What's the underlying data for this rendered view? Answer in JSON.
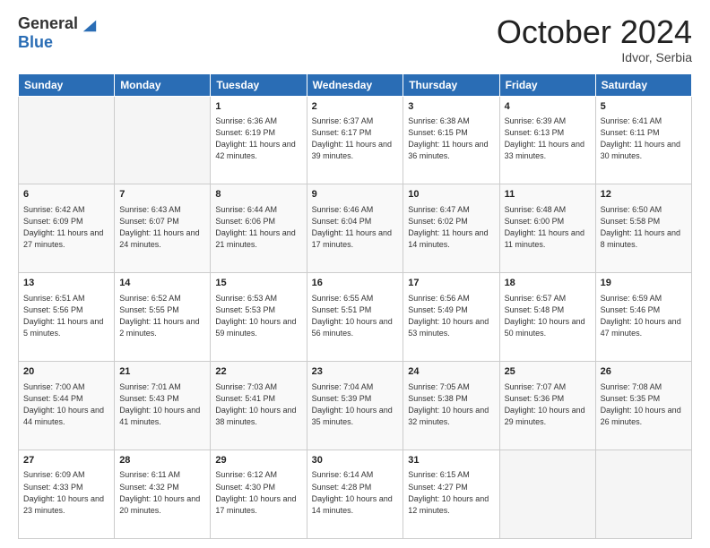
{
  "logo": {
    "general": "General",
    "blue": "Blue"
  },
  "header": {
    "month": "October 2024",
    "location": "Idvor, Serbia"
  },
  "weekdays": [
    "Sunday",
    "Monday",
    "Tuesday",
    "Wednesday",
    "Thursday",
    "Friday",
    "Saturday"
  ],
  "weeks": [
    [
      {
        "day": "",
        "sunrise": "",
        "sunset": "",
        "daylight": ""
      },
      {
        "day": "",
        "sunrise": "",
        "sunset": "",
        "daylight": ""
      },
      {
        "day": "1",
        "sunrise": "Sunrise: 6:36 AM",
        "sunset": "Sunset: 6:19 PM",
        "daylight": "Daylight: 11 hours and 42 minutes."
      },
      {
        "day": "2",
        "sunrise": "Sunrise: 6:37 AM",
        "sunset": "Sunset: 6:17 PM",
        "daylight": "Daylight: 11 hours and 39 minutes."
      },
      {
        "day": "3",
        "sunrise": "Sunrise: 6:38 AM",
        "sunset": "Sunset: 6:15 PM",
        "daylight": "Daylight: 11 hours and 36 minutes."
      },
      {
        "day": "4",
        "sunrise": "Sunrise: 6:39 AM",
        "sunset": "Sunset: 6:13 PM",
        "daylight": "Daylight: 11 hours and 33 minutes."
      },
      {
        "day": "5",
        "sunrise": "Sunrise: 6:41 AM",
        "sunset": "Sunset: 6:11 PM",
        "daylight": "Daylight: 11 hours and 30 minutes."
      }
    ],
    [
      {
        "day": "6",
        "sunrise": "Sunrise: 6:42 AM",
        "sunset": "Sunset: 6:09 PM",
        "daylight": "Daylight: 11 hours and 27 minutes."
      },
      {
        "day": "7",
        "sunrise": "Sunrise: 6:43 AM",
        "sunset": "Sunset: 6:07 PM",
        "daylight": "Daylight: 11 hours and 24 minutes."
      },
      {
        "day": "8",
        "sunrise": "Sunrise: 6:44 AM",
        "sunset": "Sunset: 6:06 PM",
        "daylight": "Daylight: 11 hours and 21 minutes."
      },
      {
        "day": "9",
        "sunrise": "Sunrise: 6:46 AM",
        "sunset": "Sunset: 6:04 PM",
        "daylight": "Daylight: 11 hours and 17 minutes."
      },
      {
        "day": "10",
        "sunrise": "Sunrise: 6:47 AM",
        "sunset": "Sunset: 6:02 PM",
        "daylight": "Daylight: 11 hours and 14 minutes."
      },
      {
        "day": "11",
        "sunrise": "Sunrise: 6:48 AM",
        "sunset": "Sunset: 6:00 PM",
        "daylight": "Daylight: 11 hours and 11 minutes."
      },
      {
        "day": "12",
        "sunrise": "Sunrise: 6:50 AM",
        "sunset": "Sunset: 5:58 PM",
        "daylight": "Daylight: 11 hours and 8 minutes."
      }
    ],
    [
      {
        "day": "13",
        "sunrise": "Sunrise: 6:51 AM",
        "sunset": "Sunset: 5:56 PM",
        "daylight": "Daylight: 11 hours and 5 minutes."
      },
      {
        "day": "14",
        "sunrise": "Sunrise: 6:52 AM",
        "sunset": "Sunset: 5:55 PM",
        "daylight": "Daylight: 11 hours and 2 minutes."
      },
      {
        "day": "15",
        "sunrise": "Sunrise: 6:53 AM",
        "sunset": "Sunset: 5:53 PM",
        "daylight": "Daylight: 10 hours and 59 minutes."
      },
      {
        "day": "16",
        "sunrise": "Sunrise: 6:55 AM",
        "sunset": "Sunset: 5:51 PM",
        "daylight": "Daylight: 10 hours and 56 minutes."
      },
      {
        "day": "17",
        "sunrise": "Sunrise: 6:56 AM",
        "sunset": "Sunset: 5:49 PM",
        "daylight": "Daylight: 10 hours and 53 minutes."
      },
      {
        "day": "18",
        "sunrise": "Sunrise: 6:57 AM",
        "sunset": "Sunset: 5:48 PM",
        "daylight": "Daylight: 10 hours and 50 minutes."
      },
      {
        "day": "19",
        "sunrise": "Sunrise: 6:59 AM",
        "sunset": "Sunset: 5:46 PM",
        "daylight": "Daylight: 10 hours and 47 minutes."
      }
    ],
    [
      {
        "day": "20",
        "sunrise": "Sunrise: 7:00 AM",
        "sunset": "Sunset: 5:44 PM",
        "daylight": "Daylight: 10 hours and 44 minutes."
      },
      {
        "day": "21",
        "sunrise": "Sunrise: 7:01 AM",
        "sunset": "Sunset: 5:43 PM",
        "daylight": "Daylight: 10 hours and 41 minutes."
      },
      {
        "day": "22",
        "sunrise": "Sunrise: 7:03 AM",
        "sunset": "Sunset: 5:41 PM",
        "daylight": "Daylight: 10 hours and 38 minutes."
      },
      {
        "day": "23",
        "sunrise": "Sunrise: 7:04 AM",
        "sunset": "Sunset: 5:39 PM",
        "daylight": "Daylight: 10 hours and 35 minutes."
      },
      {
        "day": "24",
        "sunrise": "Sunrise: 7:05 AM",
        "sunset": "Sunset: 5:38 PM",
        "daylight": "Daylight: 10 hours and 32 minutes."
      },
      {
        "day": "25",
        "sunrise": "Sunrise: 7:07 AM",
        "sunset": "Sunset: 5:36 PM",
        "daylight": "Daylight: 10 hours and 29 minutes."
      },
      {
        "day": "26",
        "sunrise": "Sunrise: 7:08 AM",
        "sunset": "Sunset: 5:35 PM",
        "daylight": "Daylight: 10 hours and 26 minutes."
      }
    ],
    [
      {
        "day": "27",
        "sunrise": "Sunrise: 6:09 AM",
        "sunset": "Sunset: 4:33 PM",
        "daylight": "Daylight: 10 hours and 23 minutes."
      },
      {
        "day": "28",
        "sunrise": "Sunrise: 6:11 AM",
        "sunset": "Sunset: 4:32 PM",
        "daylight": "Daylight: 10 hours and 20 minutes."
      },
      {
        "day": "29",
        "sunrise": "Sunrise: 6:12 AM",
        "sunset": "Sunset: 4:30 PM",
        "daylight": "Daylight: 10 hours and 17 minutes."
      },
      {
        "day": "30",
        "sunrise": "Sunrise: 6:14 AM",
        "sunset": "Sunset: 4:28 PM",
        "daylight": "Daylight: 10 hours and 14 minutes."
      },
      {
        "day": "31",
        "sunrise": "Sunrise: 6:15 AM",
        "sunset": "Sunset: 4:27 PM",
        "daylight": "Daylight: 10 hours and 12 minutes."
      },
      {
        "day": "",
        "sunrise": "",
        "sunset": "",
        "daylight": ""
      },
      {
        "day": "",
        "sunrise": "",
        "sunset": "",
        "daylight": ""
      }
    ]
  ]
}
